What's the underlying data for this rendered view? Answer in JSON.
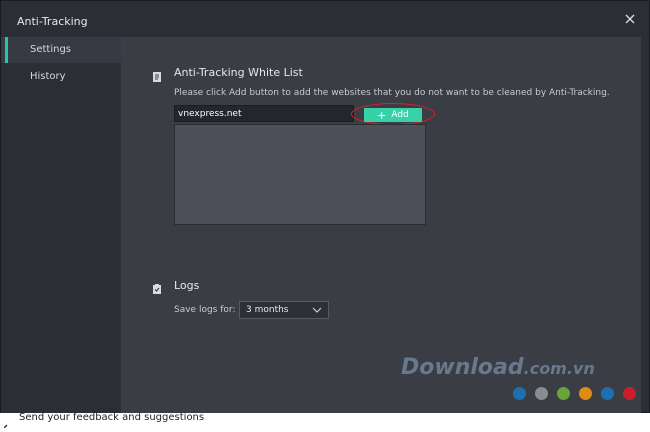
{
  "window": {
    "title": "Anti-Tracking"
  },
  "sidebar": {
    "items": [
      {
        "label": "Settings",
        "active": true
      },
      {
        "label": "History",
        "active": false
      }
    ]
  },
  "whitelist": {
    "title": "Anti-Tracking White List",
    "description": "Please click Add button to add the websites that you do not want to be cleaned by Anti-Tracking.",
    "input_value": "vnexpress.net",
    "add_label": "Add",
    "entries": []
  },
  "logs": {
    "title": "Logs",
    "save_label": "Save logs for:",
    "selected": "3 months"
  },
  "watermark": {
    "brand": "Download",
    "suffix": ".com.vn"
  },
  "watermark_dot_colors": [
    "#1e6fb0",
    "#8a8c8f",
    "#6aa33a",
    "#e08a18",
    "#1e6fb0",
    "#c8202a"
  ],
  "footer": {
    "feedback": "Send your feedback and suggestions"
  },
  "colors": {
    "accent": "#38d0a9",
    "highlight": "#e0202a"
  }
}
